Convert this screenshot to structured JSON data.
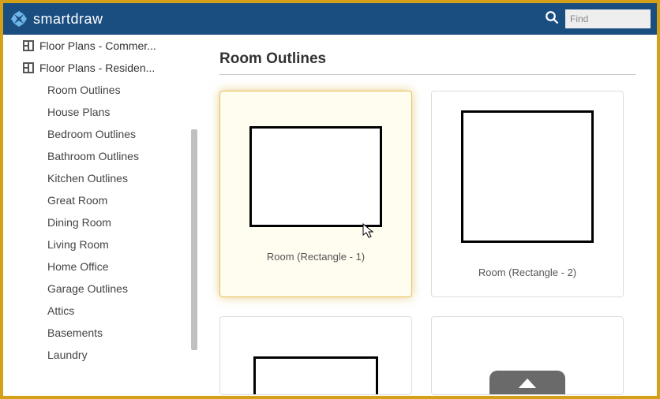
{
  "header": {
    "brand": "smartdraw",
    "search_placeholder": "Find"
  },
  "sidebar": {
    "categories": [
      {
        "label": "Floor Plans - Commer..."
      },
      {
        "label": "Floor Plans - Residen..."
      }
    ],
    "items": [
      {
        "label": "Room Outlines"
      },
      {
        "label": "House Plans"
      },
      {
        "label": "Bedroom Outlines"
      },
      {
        "label": "Bathroom Outlines"
      },
      {
        "label": "Kitchen Outlines"
      },
      {
        "label": "Great Room"
      },
      {
        "label": "Dining Room"
      },
      {
        "label": "Living Room"
      },
      {
        "label": "Home Office"
      },
      {
        "label": "Garage Outlines"
      },
      {
        "label": "Attics"
      },
      {
        "label": "Basements"
      },
      {
        "label": "Laundry"
      }
    ]
  },
  "content": {
    "title": "Room Outlines",
    "cards": [
      {
        "label": "Room (Rectangle - 1)"
      },
      {
        "label": "Room (Rectangle - 2)"
      }
    ]
  }
}
